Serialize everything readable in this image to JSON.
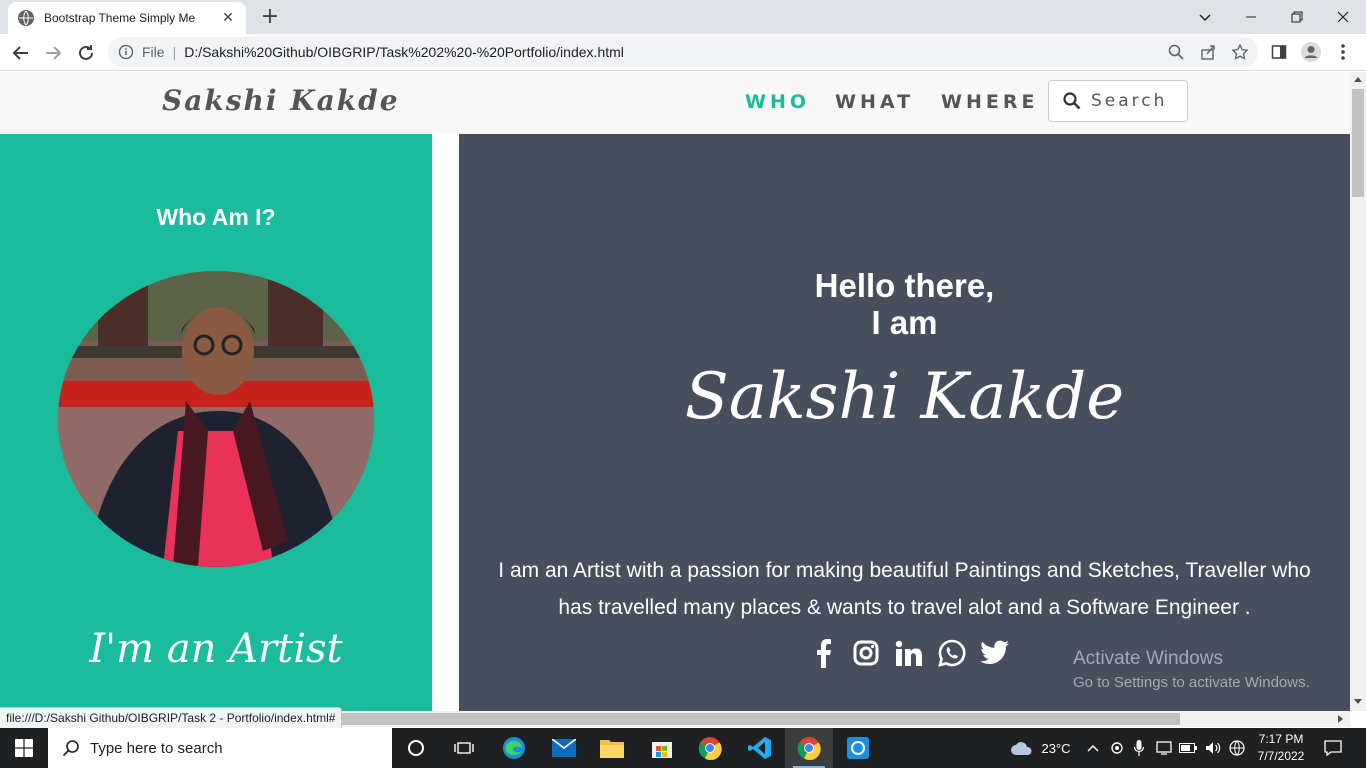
{
  "browser": {
    "tab_title": "Bootstrap Theme Simply Me",
    "file_label": "File",
    "url": "D:/Sakshi%20Github/OIBGRIP/Task%202%20-%20Portfolio/index.html",
    "status_url": "file:///D:/Sakshi Github/OIBGRIP/Task 2 - Portfolio/index.html#"
  },
  "nav": {
    "brand": "Sakshi Kakde",
    "links": [
      "WHO",
      "WHAT",
      "WHERE"
    ],
    "active_link": "WHO",
    "search_placeholder": "Search"
  },
  "left": {
    "title": "Who Am I?",
    "tagline": "I'm an Artist"
  },
  "right": {
    "greeting_line1": "Hello there,",
    "greeting_line2": "I am",
    "name": "Sakshi Kakde",
    "bio": "I am an Artist with a passion for making beautiful Paintings and Sketches, Traveller who has travelled many places & wants to travel alot and a Software Engineer .",
    "socials": [
      "facebook-icon",
      "instagram-icon",
      "linkedin-icon",
      "whatsapp-icon",
      "twitter-icon"
    ]
  },
  "watermark": {
    "line1": "Activate Windows",
    "line2": "Go to Settings to activate Windows."
  },
  "taskbar": {
    "search_placeholder": "Type here to search",
    "weather": "23°C",
    "time": "7:17 PM",
    "date": "7/7/2022"
  },
  "colors": {
    "accent": "#1abc9c",
    "dark_panel": "#474e5d",
    "nav_bg": "#f8f8f8"
  }
}
